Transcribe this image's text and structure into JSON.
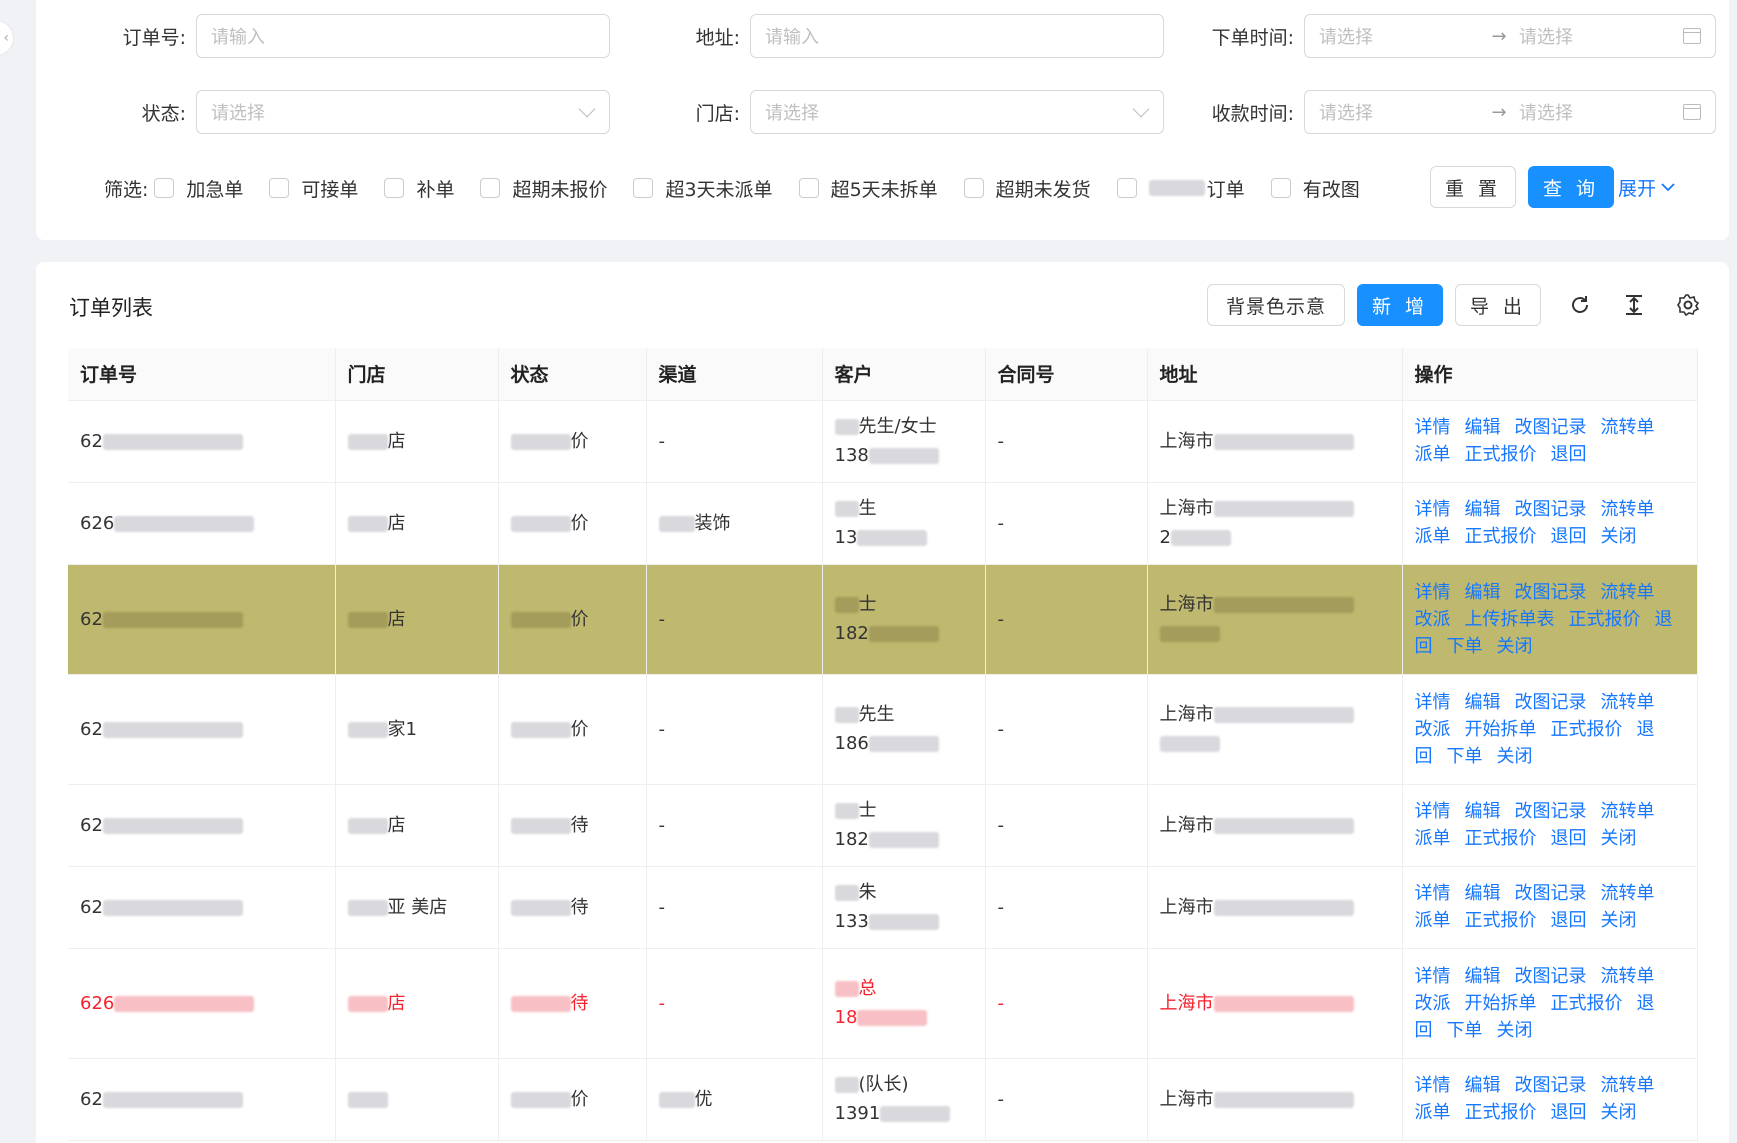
{
  "filters": {
    "order_no": {
      "label": "订单号:",
      "placeholder": "请输入"
    },
    "address": {
      "label": "地址:",
      "placeholder": "请输入"
    },
    "order_time": {
      "label": "下单时间:",
      "start": "请选择",
      "end": "请选择"
    },
    "status": {
      "label": "状态:",
      "placeholder": "请选择"
    },
    "store": {
      "label": "门店:",
      "placeholder": "请选择"
    },
    "pay_time": {
      "label": "收款时间:",
      "start": "请选择",
      "end": "请选择"
    },
    "screen_label": "筛选:",
    "checkboxes": [
      "加急单",
      "可接单",
      "补单",
      "超期未报价",
      "超3天未派单",
      "超5天未拆单",
      "超期未发货",
      "订单",
      "有改图"
    ],
    "reset": "重 置",
    "query": "查 询",
    "expand": "展开"
  },
  "list": {
    "title": "订单列表",
    "bg_legend": "背景色示意",
    "add": "新 增",
    "export": "导 出",
    "columns": [
      "订单号",
      "门店",
      "状态",
      "渠道",
      "客户",
      "合同号",
      "地址",
      "操作"
    ],
    "rows": [
      {
        "order": "62",
        "store": "店",
        "status": "价",
        "channel": "-",
        "cust1": "先生/女士",
        "cust2": "138",
        "contract": "-",
        "addr1": "上海市",
        "addr2": "",
        "ops": [
          "详情",
          "编辑",
          "改图记录",
          "流转单",
          "派单",
          "正式报价",
          "退回"
        ]
      },
      {
        "order": "626",
        "store": "店",
        "status": "价",
        "channel": "装饰",
        "cust1": "生",
        "cust2": "13",
        "contract": "-",
        "addr1": "上海市",
        "addr2": "2",
        "ops": [
          "详情",
          "编辑",
          "改图记录",
          "流转单",
          "派单",
          "正式报价",
          "退回",
          "关闭"
        ]
      },
      {
        "order": "62",
        "store": "店",
        "status": "价",
        "channel": "-",
        "cust1": "士",
        "cust2": "182",
        "contract": "-",
        "addr1": "上海市",
        "addr2": "",
        "ops": [
          "详情",
          "编辑",
          "改图记录",
          "流转单",
          "改派",
          "上传拆单表",
          "正式报价",
          "退",
          "回",
          "下单",
          "关闭"
        ]
      },
      {
        "order": "62",
        "store": "家1",
        "status": "价",
        "channel": "-",
        "cust1": "先生",
        "cust2": "186",
        "contract": "-",
        "addr1": "上海市",
        "addr2": "",
        "ops": [
          "详情",
          "编辑",
          "改图记录",
          "流转单",
          "改派",
          "开始拆单",
          "正式报价",
          "退",
          "回",
          "下单",
          "关闭"
        ]
      },
      {
        "order": "62",
        "store": "店",
        "status": "待",
        "channel": "-",
        "cust1": "士",
        "cust2": "182",
        "contract": "-",
        "addr1": "上海市",
        "addr2": "",
        "ops": [
          "详情",
          "编辑",
          "改图记录",
          "流转单",
          "派单",
          "正式报价",
          "退回",
          "关闭"
        ]
      },
      {
        "order": "62",
        "store": "亚 美店",
        "status": "待",
        "channel": "-",
        "cust1": "朱",
        "cust2": "133",
        "contract": "-",
        "addr1": "上海市",
        "addr2": "",
        "ops": [
          "详情",
          "编辑",
          "改图记录",
          "流转单",
          "派单",
          "正式报价",
          "退回",
          "关闭"
        ]
      },
      {
        "order": "626",
        "store": "店",
        "status": "待",
        "channel": "-",
        "cust1": "总",
        "cust2": "18",
        "contract": "-",
        "addr1": "上海市",
        "addr2": "",
        "ops": [
          "详情",
          "编辑",
          "改图记录",
          "流转单",
          "改派",
          "开始拆单",
          "正式报价",
          "退",
          "回",
          "下单",
          "关闭"
        ]
      },
      {
        "order": "62",
        "store": "",
        "status": "价",
        "channel": "优",
        "cust1": "(队长)",
        "cust2": "1391",
        "contract": "-",
        "addr1": "上海市",
        "addr2": "",
        "ops": [
          "详情",
          "编辑",
          "改图记录",
          "流转单",
          "派单",
          "正式报价",
          "退回",
          "关闭"
        ]
      }
    ]
  },
  "colors": {
    "primary": "#1890ff",
    "link": "#1677ff",
    "highlight_row": "#bfb86f",
    "warning_text": "#f5222d"
  }
}
